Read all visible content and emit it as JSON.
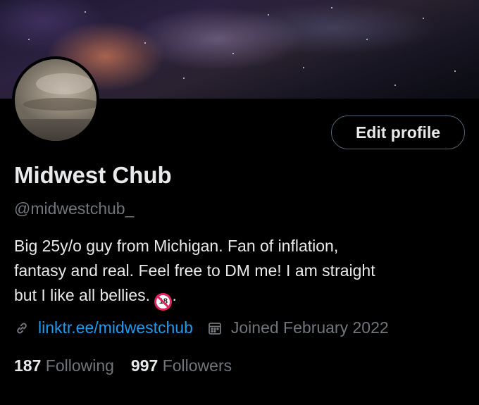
{
  "profile": {
    "name": "Midwest Chub",
    "handle": "@midwestchub_",
    "edit_label": "Edit profile",
    "bio": {
      "line1": "Big 25y/o guy from Michigan. Fan of inflation,",
      "line2": "fantasy and real. Feel free to DM me! I am straight",
      "line3": "but I like all bellies.",
      "badge": "18",
      "end": "."
    },
    "link": "linktr.ee/midwestchub",
    "joined": "Joined February 2022",
    "following_count": "187",
    "following_label": "Following",
    "followers_count": "997",
    "followers_label": "Followers"
  },
  "icons": {
    "link": "link-icon",
    "calendar": "calendar-icon",
    "adult": "no-under-18-icon"
  },
  "colors": {
    "background": "#000000",
    "accent": "#1d9bf0",
    "muted": "#71767b",
    "text": "#e7e9ea",
    "border": "#536471"
  }
}
